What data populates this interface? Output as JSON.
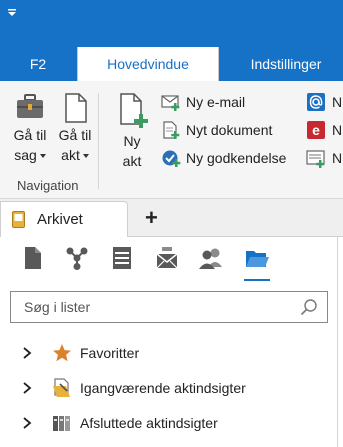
{
  "colors": {
    "accent": "#1672c6",
    "ribbon_bg": "#f5f5f5"
  },
  "tabs": [
    {
      "label": "F2"
    },
    {
      "label": "Hovedvindue",
      "active": true
    },
    {
      "label": "Indstillinger"
    }
  ],
  "ribbon": {
    "navigation": {
      "goto_case": {
        "line1": "Gå til",
        "line2": "sag",
        "icon": "briefcase-icon"
      },
      "goto_record": {
        "line1": "Gå til",
        "line2": "akt",
        "icon": "document-icon"
      },
      "group_label": "Navigation"
    },
    "new_record": {
      "line1": "Ny",
      "line2": "akt",
      "icon": "new-document-icon"
    },
    "small_buttons": [
      {
        "label": "Ny e-mail",
        "icon": "new-email-icon"
      },
      {
        "label": "Nyt dokument",
        "icon": "new-document-small-icon"
      },
      {
        "label": "Ny godkendelse",
        "icon": "approval-check-icon"
      }
    ],
    "cut_off_buttons": [
      {
        "label": "N",
        "icon": "at-sign-icon"
      },
      {
        "label": "N",
        "icon": "e-letter-icon"
      },
      {
        "label": "N",
        "icon": "form-icon"
      }
    ]
  },
  "document_tabs": {
    "active": {
      "label": "Arkivet",
      "icon": "archive-icon"
    },
    "add_label": "+"
  },
  "panel": {
    "icons": [
      "document-icon",
      "org-chart-icon",
      "list-icon",
      "mail-icon",
      "users-icon",
      "open-folder-icon"
    ],
    "active_icon_index": 5,
    "search_placeholder": "Søg i lister",
    "tree": [
      {
        "label": "Favoritter",
        "icon": "star-icon"
      },
      {
        "label": "Igangværende aktindsigter",
        "icon": "pending-folder-icon"
      },
      {
        "label": "Afsluttede aktindsigter",
        "icon": "completed-binders-icon"
      }
    ]
  }
}
